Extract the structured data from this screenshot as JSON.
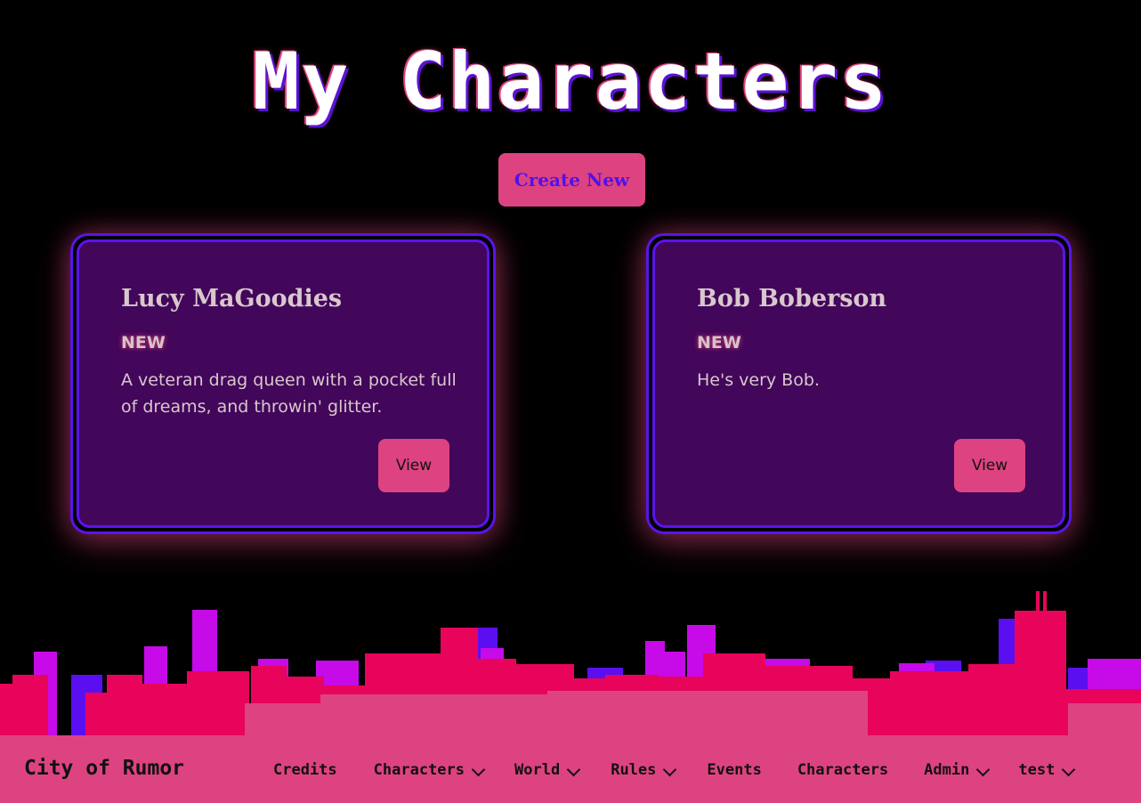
{
  "page": {
    "title": "My Characters",
    "create_button": "Create New"
  },
  "characters": [
    {
      "name": "Lucy MaGoodies",
      "status": "NEW",
      "description": "A veteran drag queen with a pocket full of dreams, and throwin' glitter.",
      "view_label": "View"
    },
    {
      "name": "Bob Boberson",
      "status": "NEW",
      "description": "He's very Bob.",
      "view_label": "View"
    }
  ],
  "navbar": {
    "brand": "City of Rumor",
    "items": [
      {
        "label": "Credits",
        "dropdown": false
      },
      {
        "label": "Characters",
        "dropdown": true
      },
      {
        "label": "World",
        "dropdown": true
      },
      {
        "label": "Rules",
        "dropdown": true
      },
      {
        "label": "Events",
        "dropdown": false
      },
      {
        "label": "Characters",
        "dropdown": false
      },
      {
        "label": "Admin",
        "dropdown": true
      },
      {
        "label": "test",
        "dropdown": true
      }
    ]
  },
  "colors": {
    "accent_pink": "#dd4381",
    "accent_purple": "#5a14ea",
    "card_bg": "#42065a",
    "skyline_red": "#e8045a",
    "skyline_magenta": "#c60ae8",
    "skyline_blue": "#5a0ff0"
  }
}
